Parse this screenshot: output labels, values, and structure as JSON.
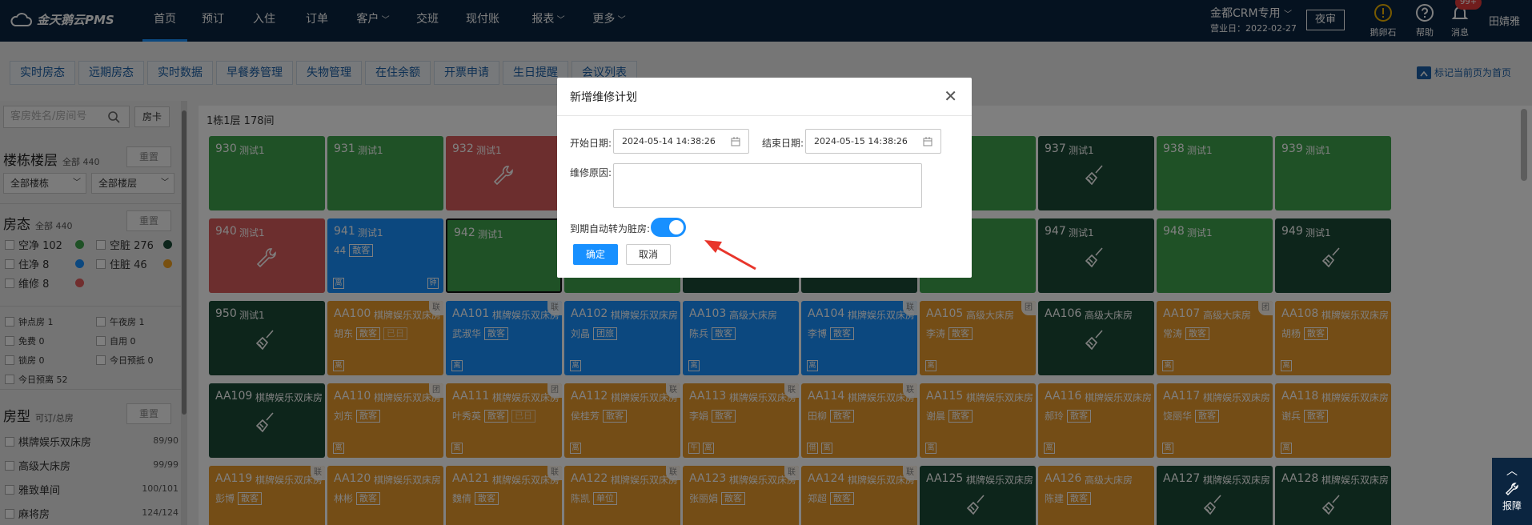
{
  "app": {
    "brand": "金天鹅云PMS"
  },
  "nav": {
    "items": [
      "首页",
      "预订",
      "入住",
      "订单",
      "客户",
      "交班",
      "现付账",
      "报表",
      "更多"
    ],
    "active": 0
  },
  "topright": {
    "account": "金都CRM专用",
    "business_date": "营业日：2022-02-27",
    "night_audit": "夜审",
    "egg_label": "鹅卵石",
    "help_label": "帮助",
    "msg_label": "消息",
    "msg_badge": "99+",
    "user": "田婧雅"
  },
  "tabs": [
    "实时房态",
    "远期房态",
    "实时数据",
    "早餐券管理",
    "失物管理",
    "在住余额",
    "开票申请",
    "生日提醒",
    "会议列表"
  ],
  "bookmark": "标记当前页为首页",
  "sidebar": {
    "search_placeholder": "客房姓名/房间号",
    "room_card": "房卡",
    "reset": "重置",
    "building_title": "楼栋楼层",
    "building_total": "全部 440",
    "select_building": "全部楼栋",
    "select_floor": "全部楼层",
    "status_title": "房态",
    "status_total": "全部 440",
    "statuses": [
      {
        "label": "空净 102",
        "color": "#3fa34d"
      },
      {
        "label": "空脏 276",
        "color": "#1b4a36"
      },
      {
        "label": "住净 8",
        "color": "#1890ff"
      },
      {
        "label": "住脏 46",
        "color": "#f0a020"
      },
      {
        "label": "维修 8",
        "color": "#e35d5d"
      }
    ],
    "flags": [
      "钟点房 1",
      "午夜房 1",
      "免费 0",
      "自用 0",
      "锁房 0",
      "今日预抵 0",
      "今日预离 52"
    ],
    "type_title": "房型",
    "type_sub": "可订/总房",
    "types": [
      {
        "label": "棋牌娱乐双床房",
        "count": "89/90"
      },
      {
        "label": "高级大床房",
        "count": "99/99"
      },
      {
        "label": "雅致单间",
        "count": "100/101"
      },
      {
        "label": "麻将房",
        "count": "124/124"
      }
    ]
  },
  "floor_label": "1栋1层 178间",
  "colors": {
    "green": "#3fa34d",
    "dark": "#1b4a36",
    "blue": "#1890ff",
    "orange": "#e89a2c",
    "red": "#d95c5c"
  },
  "rooms": [
    {
      "num": "930",
      "name": "测试1",
      "color": "green",
      "row": 0,
      "col": 0
    },
    {
      "num": "931",
      "name": "测试1",
      "color": "green",
      "row": 0,
      "col": 1
    },
    {
      "num": "932",
      "name": "测试1",
      "color": "red",
      "row": 0,
      "col": 2,
      "icon": "wrench-icon"
    },
    {
      "num": "",
      "name": "",
      "color": "green",
      "row": 0,
      "col": 3
    },
    {
      "num": "",
      "name": "",
      "color": "dark",
      "row": 0,
      "col": 4
    },
    {
      "num": "",
      "name": "",
      "color": "green",
      "row": 0,
      "col": 5
    },
    {
      "num": "",
      "name": "",
      "color": "green",
      "row": 0,
      "col": 6
    },
    {
      "num": "937",
      "name": "测试1",
      "color": "dark",
      "row": 0,
      "col": 7,
      "icon": "broom-icon"
    },
    {
      "num": "938",
      "name": "测试1",
      "color": "green",
      "row": 0,
      "col": 8
    },
    {
      "num": "939",
      "name": "测试1",
      "color": "green",
      "row": 0,
      "col": 9
    },
    {
      "num": "940",
      "name": "测试1",
      "color": "red",
      "row": 1,
      "col": 0,
      "icon": "wrench-icon"
    },
    {
      "num": "941",
      "name": "测试1",
      "color": "blue",
      "row": 1,
      "col": 1,
      "guest": "44",
      "tags": [
        "散客"
      ],
      "flag": "离",
      "right": "钟"
    },
    {
      "num": "942",
      "name": "测试1",
      "color": "green",
      "row": 1,
      "col": 2,
      "selected": true
    },
    {
      "num": "",
      "name": "",
      "color": "green",
      "row": 1,
      "col": 3
    },
    {
      "num": "",
      "name": "",
      "color": "dark",
      "row": 1,
      "col": 4
    },
    {
      "num": "",
      "name": "",
      "color": "dark",
      "row": 1,
      "col": 5
    },
    {
      "num": "",
      "name": "",
      "color": "green",
      "row": 1,
      "col": 6
    },
    {
      "num": "947",
      "name": "测试1",
      "color": "dark",
      "row": 1,
      "col": 7,
      "icon": "broom-icon"
    },
    {
      "num": "948",
      "name": "测试1",
      "color": "green",
      "row": 1,
      "col": 8
    },
    {
      "num": "949",
      "name": "测试1",
      "color": "dark",
      "row": 1,
      "col": 9,
      "icon": "broom-icon"
    },
    {
      "num": "950",
      "name": "测试1",
      "color": "dark",
      "row": 2,
      "col": 0,
      "icon": "broom-icon"
    },
    {
      "num": "AA100",
      "name": "棋牌娱乐双床房",
      "color": "orange",
      "row": 2,
      "col": 1,
      "guest": "胡东",
      "tags": [
        "散客",
        "已日"
      ],
      "flag": "离",
      "corner": "联"
    },
    {
      "num": "AA101",
      "name": "棋牌娱乐双床房",
      "color": "blue",
      "row": 2,
      "col": 2,
      "guest": "武淑华",
      "tags": [
        "散客"
      ],
      "flag": "离",
      "corner": "联"
    },
    {
      "num": "AA102",
      "name": "棋牌娱乐双床房",
      "color": "blue",
      "row": 2,
      "col": 3,
      "guest": "刘晶",
      "tags": [
        "团旅"
      ],
      "flag": "离"
    },
    {
      "num": "AA103",
      "name": "高级大床房",
      "color": "blue",
      "row": 2,
      "col": 4,
      "guest": "陈兵",
      "tags": [
        "散客"
      ],
      "flag": "离"
    },
    {
      "num": "AA104",
      "name": "棋牌娱乐双床房",
      "color": "blue",
      "row": 2,
      "col": 5,
      "guest": "李博",
      "tags": [
        "散客"
      ],
      "flag": "离",
      "corner": "联"
    },
    {
      "num": "AA105",
      "name": "高级大床房",
      "color": "orange",
      "row": 2,
      "col": 6,
      "guest": "李涛",
      "tags": [
        "散客"
      ],
      "flag": "离",
      "corner": "团"
    },
    {
      "num": "AA106",
      "name": "高级大床房",
      "color": "dark",
      "row": 2,
      "col": 7,
      "icon": "broom-icon"
    },
    {
      "num": "AA107",
      "name": "高级大床房",
      "color": "orange",
      "row": 2,
      "col": 8,
      "guest": "常涛",
      "tags": [
        "散客"
      ],
      "flag": "离",
      "corner": "团"
    },
    {
      "num": "AA108",
      "name": "棋牌娱乐双床房",
      "color": "orange",
      "row": 2,
      "col": 9,
      "guest": "胡杨",
      "tags": [
        "散客"
      ],
      "flag": "离"
    },
    {
      "num": "AA109",
      "name": "棋牌娱乐双床房",
      "color": "dark",
      "row": 3,
      "col": 0,
      "icon": "broom-icon"
    },
    {
      "num": "AA110",
      "name": "棋牌娱乐双床房",
      "color": "orange",
      "row": 3,
      "col": 1,
      "guest": "刘东",
      "tags": [
        "散客"
      ],
      "flag": "离",
      "corner": "团"
    },
    {
      "num": "AA111",
      "name": "棋牌娱乐双床房",
      "color": "orange",
      "row": 3,
      "col": 2,
      "guest": "叶秀英",
      "tags": [
        "散客",
        "已日"
      ],
      "flag": "离",
      "corner": "团"
    },
    {
      "num": "AA112",
      "name": "棋牌娱乐双床房",
      "color": "orange",
      "row": 3,
      "col": 3,
      "guest": "侯桂芳",
      "tags": [
        "散客"
      ],
      "flag": "离",
      "corner": "联"
    },
    {
      "num": "AA113",
      "name": "棋牌娱乐双床房",
      "color": "orange",
      "row": 3,
      "col": 4,
      "guest": "李娟",
      "tags": [
        "散客"
      ],
      "flag": "午",
      "flag2": "离",
      "corner": "联"
    },
    {
      "num": "AA114",
      "name": "棋牌娱乐双床房",
      "color": "orange",
      "row": 3,
      "col": 5,
      "guest": "田柳",
      "tags": [
        "散客"
      ],
      "flag": "借",
      "flag2": "离",
      "corner": "联"
    },
    {
      "num": "AA115",
      "name": "棋牌娱乐双床房",
      "color": "orange",
      "row": 3,
      "col": 6,
      "guest": "谢晨",
      "tags": [
        "散客"
      ],
      "flag": "离"
    },
    {
      "num": "AA116",
      "name": "棋牌娱乐双床房",
      "color": "orange",
      "row": 3,
      "col": 7,
      "guest": "郝玲",
      "tags": [
        "散客"
      ],
      "flag": "离"
    },
    {
      "num": "AA117",
      "name": "棋牌娱乐双床房",
      "color": "orange",
      "row": 3,
      "col": 8,
      "guest": "饶丽华",
      "tags": [
        "散客"
      ],
      "flag": "离"
    },
    {
      "num": "AA118",
      "name": "棋牌娱乐双床房",
      "color": "orange",
      "row": 3,
      "col": 9,
      "guest": "谢兵",
      "tags": [
        "散客"
      ],
      "flag": "离"
    },
    {
      "num": "AA119",
      "name": "棋牌娱乐双床房",
      "color": "orange",
      "row": 4,
      "col": 0,
      "guest": "彭博",
      "tags": [
        "散客"
      ],
      "corner": "联"
    },
    {
      "num": "AA120",
      "name": "棋牌娱乐双床房",
      "color": "orange",
      "row": 4,
      "col": 1,
      "guest": "林彬",
      "tags": [
        "散客"
      ]
    },
    {
      "num": "AA121",
      "name": "棋牌娱乐双床房",
      "color": "orange",
      "row": 4,
      "col": 2,
      "guest": "魏倩",
      "tags": [
        "散客"
      ],
      "corner": "联"
    },
    {
      "num": "AA122",
      "name": "棋牌娱乐双床房",
      "color": "orange",
      "row": 4,
      "col": 3,
      "guest": "陈凯",
      "tags": [
        "单位"
      ],
      "corner": "联"
    },
    {
      "num": "AA123",
      "name": "棋牌娱乐双床房",
      "color": "orange",
      "row": 4,
      "col": 4,
      "guest": "张丽娟",
      "tags": [
        "散客"
      ],
      "corner": "联"
    },
    {
      "num": "AA124",
      "name": "棋牌娱乐双床房",
      "color": "orange",
      "row": 4,
      "col": 5,
      "guest": "郑超",
      "tags": [
        "散客"
      ],
      "corner": "联"
    },
    {
      "num": "AA125",
      "name": "棋牌娱乐双床房",
      "color": "dark",
      "row": 4,
      "col": 6,
      "icon": "broom-icon"
    },
    {
      "num": "AA126",
      "name": "高级大床房",
      "color": "orange",
      "row": 4,
      "col": 7,
      "guest": "陈建",
      "tags": [
        "散客"
      ]
    },
    {
      "num": "AA127",
      "name": "棋牌娱乐双床房",
      "color": "dark",
      "row": 4,
      "col": 8,
      "icon": "broom-icon"
    },
    {
      "num": "AA128",
      "name": "棋牌娱乐双床房",
      "color": "dark",
      "row": 4,
      "col": 9,
      "icon": "broom-icon"
    }
  ],
  "modal": {
    "title": "新增维修计划",
    "start_label": "开始日期:",
    "start_value": "2024-05-14 14:38:26",
    "end_label": "结束日期:",
    "end_value": "2024-05-15 14:38:26",
    "reason_label": "维修原因:",
    "reason_value": "",
    "auto_label": "到期自动转为脏房:",
    "auto_on": true,
    "ok": "确定",
    "cancel": "取消"
  },
  "rightpanel": {
    "label": "报障"
  }
}
